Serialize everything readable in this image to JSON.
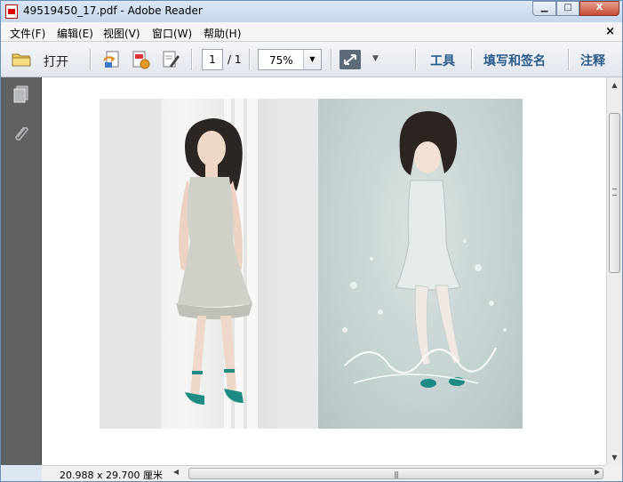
{
  "window": {
    "title": "49519450_17.pdf - Adobe Reader",
    "min_label": "▁",
    "max_label": "□",
    "close_label": "X"
  },
  "menu": {
    "items": [
      "文件(F)",
      "编辑(E)",
      "视图(V)",
      "窗口(W)",
      "帮助(H)"
    ],
    "close_label": "×"
  },
  "toolbar": {
    "open_label": "打开",
    "page_current": "1",
    "page_total": "/ 1",
    "zoom": "75%",
    "right_links": [
      "工具",
      "填写和签名",
      "注释"
    ]
  },
  "status": {
    "page_size": "20.988 x 29.700 厘米"
  },
  "colors": {
    "nav_pane": "#5f6163",
    "link_blue": "#2a5a8a"
  }
}
